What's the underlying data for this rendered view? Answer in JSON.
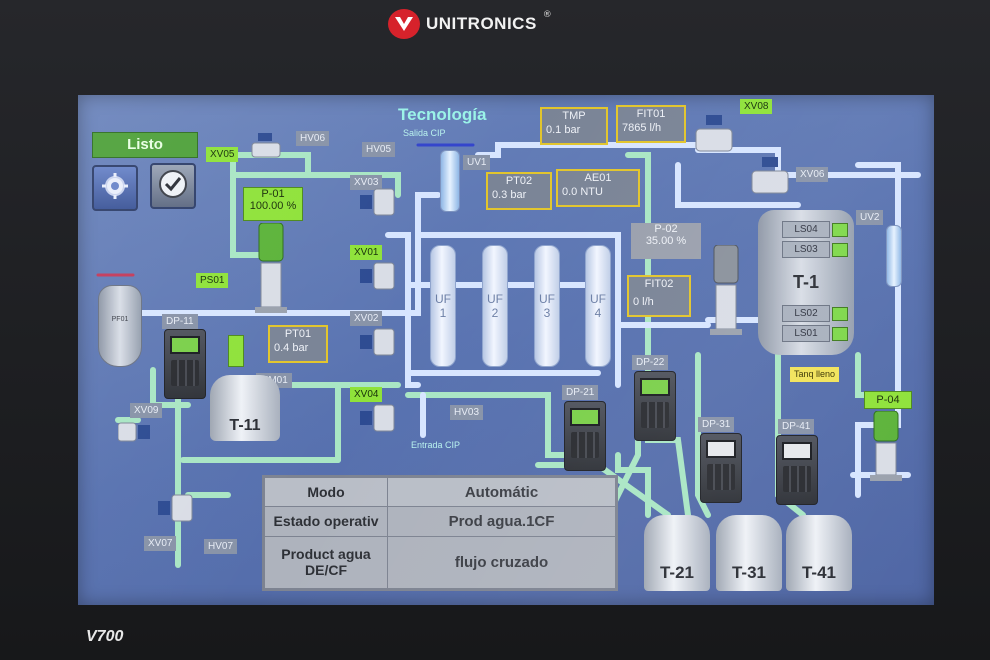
{
  "device": {
    "brand": "UNITRONICS",
    "brand_mark": "®",
    "model": "V700"
  },
  "header": {
    "title": "Tecnología",
    "subtitle": "Salida CIP",
    "entrada": "Entrada CIP"
  },
  "status": {
    "listo": "Listo"
  },
  "valves": {
    "xv05": "XV05",
    "hv06": "HV06",
    "hv05": "HV05",
    "xv03": "XV03",
    "xv01": "XV01",
    "xv02": "XV02",
    "xv04": "XV04",
    "hv03": "HV03",
    "xv09": "XV09",
    "xv07": "XV07",
    "hv07": "HV07",
    "xv08": "XV08",
    "xv06": "XV06",
    "uv1": "UV1",
    "uv2": "UV2",
    "ps01": "PS01",
    "mm01": "MM01"
  },
  "instruments": {
    "tmp": {
      "label": "TMP",
      "value": "0.1 bar"
    },
    "fit01": {
      "label": "FIT01",
      "value": "7865 l/h"
    },
    "pt02": {
      "label": "PT02",
      "value": "0.3 bar"
    },
    "ae01": {
      "label": "AE01",
      "value": "0.0 NTU"
    },
    "pt01": {
      "label": "PT01",
      "value": "0.4 bar"
    },
    "fit02": {
      "label": "FIT02",
      "value": "0 l/h"
    }
  },
  "pumps": {
    "p01": {
      "label": "P-01",
      "value": "100.00 %"
    },
    "p02": {
      "label": "P-02",
      "value": "35.00 %"
    },
    "p04": {
      "label": "P-04"
    }
  },
  "filters": [
    {
      "label": "UF",
      "num": "1"
    },
    {
      "label": "UF",
      "num": "2"
    },
    {
      "label": "UF",
      "num": "3"
    },
    {
      "label": "UF",
      "num": "4"
    }
  ],
  "dosing": {
    "dp11": "DP-11",
    "dp21": "DP-21",
    "dp22": "DP-22",
    "dp31": "DP-31",
    "dp41": "DP-41"
  },
  "tanks": {
    "t11": "T-11",
    "t1": "T-1",
    "t21": "T-21",
    "t31": "T-31",
    "t41": "T-41",
    "pf01": "PF01"
  },
  "level_switches": [
    "LS04",
    "LS03",
    "LS02",
    "LS01"
  ],
  "tank_full": "Tanq lleno",
  "mode_table": {
    "rows": [
      {
        "label": "Modo",
        "value": "Automátic"
      },
      {
        "label": "Estado operativ",
        "value": "Prod agua.1CF"
      },
      {
        "label": "Product agua DE/CF",
        "value": "flujo cruzado"
      }
    ]
  },
  "colors": {
    "screen_bg": "#5872b0",
    "pipe_green": "#a9e6c4",
    "pipe_blue": "#cfe0ff",
    "tag_green": "#8fe23a",
    "warn_yellow": "#f2e35a",
    "brand_red": "#d6222b"
  }
}
